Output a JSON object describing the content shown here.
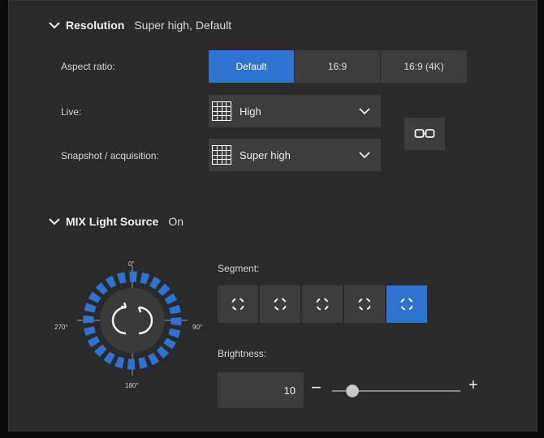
{
  "resolution": {
    "title": "Resolution",
    "summary": "Super high, Default",
    "aspect_label": "Aspect ratio:",
    "aspect_options": [
      "Default",
      "16:9",
      "16:9 (4K)"
    ],
    "aspect_selected": "Default",
    "live_label": "Live:",
    "live_value": "High",
    "snapshot_label": "Snapshot / acquisition:",
    "snapshot_value": "Super high",
    "link_icon": "link-icon"
  },
  "mix": {
    "title": "MIX Light Source",
    "summary": "On",
    "dial_labels": {
      "top": "0°",
      "right": "90°",
      "bottom": "180°",
      "left": "270°"
    },
    "segment_label": "Segment:",
    "segment_count": 5,
    "segment_selected_index": 4,
    "brightness_label": "Brightness:",
    "brightness_value": "10",
    "brightness_min_symbol": "−",
    "brightness_max_symbol": "+",
    "brightness_slider_fraction": 0.16,
    "accent_color": "#2f73d0"
  }
}
